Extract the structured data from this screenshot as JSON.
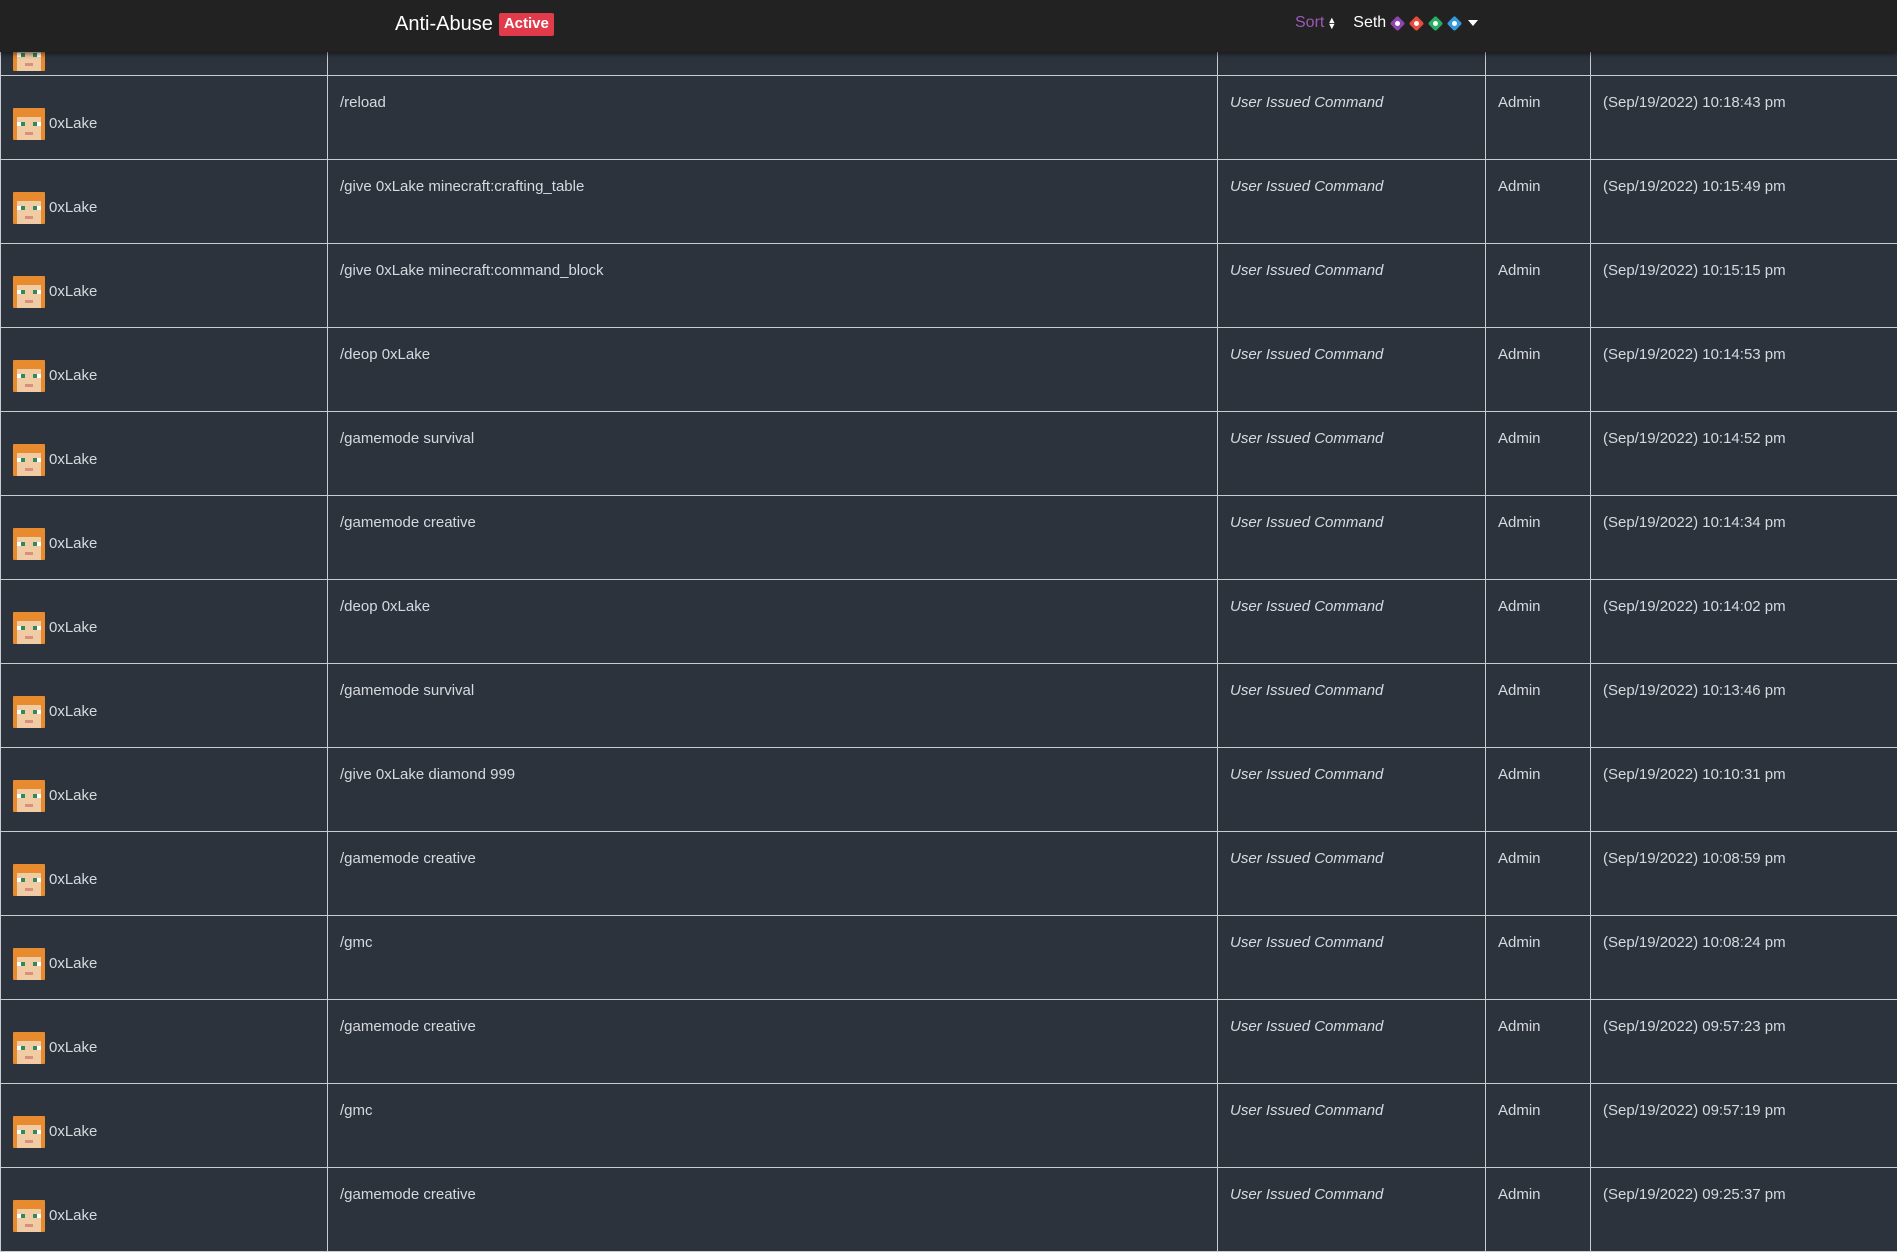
{
  "header": {
    "title": "Anti-Abuse",
    "status_badge": "Active",
    "sort_label": "Sort",
    "user_name": "Seth",
    "user_badges": [
      {
        "icon": "purple-diamond-check-icon",
        "color": "#8e44ad"
      },
      {
        "icon": "red-diamond-wrench-icon",
        "color": "#e74c3c"
      },
      {
        "icon": "green-diamond-search-icon",
        "color": "#27ae60"
      },
      {
        "icon": "blue-diamond-gem-icon",
        "color": "#3498db"
      }
    ]
  },
  "rows": [
    {
      "player": "0xLake",
      "command": "/reload",
      "type": "User Issued Command",
      "role": "Admin",
      "time": "(Sep/19/2022) 10:18:43 pm"
    },
    {
      "player": "0xLake",
      "command": "/give 0xLake minecraft:crafting_table",
      "type": "User Issued Command",
      "role": "Admin",
      "time": "(Sep/19/2022) 10:15:49 pm"
    },
    {
      "player": "0xLake",
      "command": "/give 0xLake minecraft:command_block",
      "type": "User Issued Command",
      "role": "Admin",
      "time": "(Sep/19/2022) 10:15:15 pm"
    },
    {
      "player": "0xLake",
      "command": "/deop 0xLake",
      "type": "User Issued Command",
      "role": "Admin",
      "time": "(Sep/19/2022) 10:14:53 pm"
    },
    {
      "player": "0xLake",
      "command": "/gamemode survival",
      "type": "User Issued Command",
      "role": "Admin",
      "time": "(Sep/19/2022) 10:14:52 pm"
    },
    {
      "player": "0xLake",
      "command": "/gamemode creative",
      "type": "User Issued Command",
      "role": "Admin",
      "time": "(Sep/19/2022) 10:14:34 pm"
    },
    {
      "player": "0xLake",
      "command": "/deop 0xLake",
      "type": "User Issued Command",
      "role": "Admin",
      "time": "(Sep/19/2022) 10:14:02 pm"
    },
    {
      "player": "0xLake",
      "command": "/gamemode survival",
      "type": "User Issued Command",
      "role": "Admin",
      "time": "(Sep/19/2022) 10:13:46 pm"
    },
    {
      "player": "0xLake",
      "command": "/give 0xLake diamond 999",
      "type": "User Issued Command",
      "role": "Admin",
      "time": "(Sep/19/2022) 10:10:31 pm"
    },
    {
      "player": "0xLake",
      "command": "/gamemode creative",
      "type": "User Issued Command",
      "role": "Admin",
      "time": "(Sep/19/2022) 10:08:59 pm"
    },
    {
      "player": "0xLake",
      "command": "/gmc",
      "type": "User Issued Command",
      "role": "Admin",
      "time": "(Sep/19/2022) 10:08:24 pm"
    },
    {
      "player": "0xLake",
      "command": "/gamemode creative",
      "type": "User Issued Command",
      "role": "Admin",
      "time": "(Sep/19/2022) 09:57:23 pm"
    },
    {
      "player": "0xLake",
      "command": "/gmc",
      "type": "User Issued Command",
      "role": "Admin",
      "time": "(Sep/19/2022) 09:57:19 pm"
    },
    {
      "player": "0xLake",
      "command": "/gamemode creative",
      "type": "User Issued Command",
      "role": "Admin",
      "time": "(Sep/19/2022) 09:25:37 pm"
    }
  ]
}
